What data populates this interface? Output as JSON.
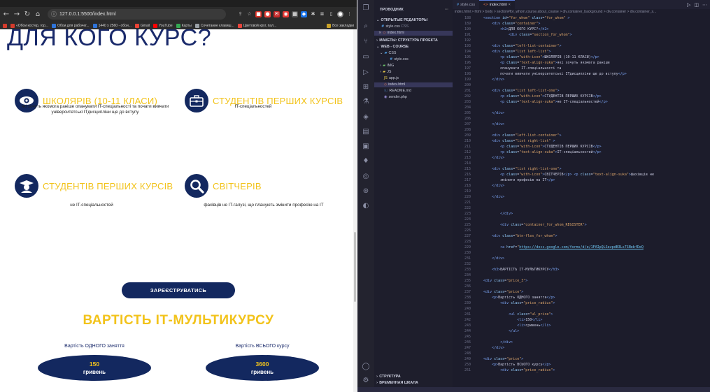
{
  "browser": {
    "url": "127.0.0.1:5500/index.html",
    "bookmarks": [
      {
        "label": "«Обои костер, гор...",
        "color": "#d33b2c"
      },
      {
        "label": "Обои для рабочег...",
        "color": "#2f74d9"
      },
      {
        "label": "1440 x 2560 - обои...",
        "color": "#2f74d9"
      },
      {
        "label": "Gmail",
        "color": "#ea4335"
      },
      {
        "label": "YouTube",
        "color": "#ff0000"
      },
      {
        "label": "Карты",
        "color": "#34a853"
      },
      {
        "label": "Сочетание клавиш...",
        "color": "#9aa0a6"
      },
      {
        "label": "Цветовой круг, пал...",
        "color": "#e8453c"
      }
    ],
    "all_bookmarks": "Все закладки"
  },
  "page": {
    "hero_title": "ДЛЯ КОГО КУРС?",
    "cards": [
      {
        "title": "ШКОЛЯРІВ (10-11 КЛАСИ)",
        "text": "які хочуть якомога раніше опанувати IT-спеціальності та почати вивчати університетські ІТдисципліни ще до вступу",
        "icon": "eye-icon"
      },
      {
        "title": "СТУДЕНТІВ ПЕРШИХ КУРСІВ",
        "text": "IT-спеціальностей",
        "icon": "briefcase-icon"
      },
      {
        "title": "СТУДЕНТІВ ПЕРШИХ КУРСІВ",
        "text": "не IT-спеціальностей",
        "icon": "graduate-icon"
      },
      {
        "title": "СВІТЧЕРІВ",
        "text": "фахівців не IT-галузі, що планують змінити професію на IT",
        "icon": "magnifier-icon"
      }
    ],
    "register_label": "ЗАРЕЄСТРУВАТИСЬ",
    "price_title": "ВАРТІСТЬ ІТ-МУЛЬТИКУРСУ",
    "prices": [
      {
        "label": "Вартість ОДНОГО заняття",
        "value": "150",
        "currency": "гривень"
      },
      {
        "label": "Вартість ВСЬОГО курсу",
        "value": "3600",
        "currency": "гривень"
      }
    ]
  },
  "vscode": {
    "explorer_title": "ПРОВОДНИК",
    "open_editors": "ОТКРЫТЫЕ РЕДАКТОРЫ",
    "open_files": [
      {
        "name": "style.css",
        "dir": "CSS"
      },
      {
        "name": "index.html",
        "dir": ""
      }
    ],
    "outline_title": "МАКЕТЫ: СТРУКТУРА ПРОЕКТА",
    "project": "WEB - COURSE",
    "tree": [
      "CSS",
      "style.css",
      "IMG",
      "JS",
      "app.js",
      "index.html",
      "README.md",
      "sender.php"
    ],
    "bottom_sections": [
      "СТРУКТУРА",
      "ВРЕМЕННАЯ ШКАЛА"
    ],
    "tabs": [
      {
        "label": "style.css",
        "icon": "#"
      },
      {
        "label": "index.html",
        "icon": "<>"
      }
    ],
    "breadcrumbs": "index.html > html > body > section#for_whom.course.about_course > div.container_background > div.container > div.container_s...",
    "code_lines": [
      {
        "n": "188",
        "html": "    <span class='t'>&lt;section</span> <span class='a'>id</span>=<span class='s'>\"for_whom\"</span> <span class='a'>class</span>=<span class='s'>\"for_whom\"</span> <span class='t'>&gt;</span>"
      },
      {
        "n": "189",
        "html": "        <span class='t'>&lt;div</span> <span class='a'>class</span>=<span class='s'>\"container\"</span><span class='t'>&gt;</span>"
      },
      {
        "n": "190",
        "html": "            <span class='t'>&lt;h2&gt;</span>ДЛЯ КОГО КУРС?<span class='t'>&lt;/h2&gt;</span>"
      },
      {
        "n": "191",
        "html": "                <span class='t'>&lt;div</span> <span class='a'>class</span>=<span class='s'>\"section_for_whom\"</span><span class='t'>&gt;</span>"
      },
      {
        "n": "192",
        "html": ""
      },
      {
        "n": "193",
        "html": "        <span class='t'>&lt;div</span> <span class='a'>class</span>=<span class='s'>\"left-list-container\"</span><span class='t'>&gt;</span>"
      },
      {
        "n": "194",
        "html": "        <span class='t'>&lt;div</span> <span class='a'>class</span>=<span class='s'>\"list left-list\"</span><span class='t'>&gt;</span>"
      },
      {
        "n": "195",
        "html": "            <span class='t'>&lt;p</span> <span class='a'>class</span>=<span class='s'>\"with-icon\"</span><span class='t'>&gt;</span>ШКОЛЯРІВ (10-11 КЛАСИ)<span class='t'>&lt;/p&gt;</span>"
      },
      {
        "n": "196",
        "html": "            <span class='t'>&lt;p</span> <span class='a'>class</span>=<span class='s'>\"text-align-suka\"</span><span class='t'>&gt;</span>які хочуть якомога раніше"
      },
      {
        "n": "197",
        "html": "            опанувати IT-спеціальності та"
      },
      {
        "n": "198",
        "html": "            почати вивчати університетські ІТдисципліни ще до вступу<span class='t'>&lt;/p&gt;</span>"
      },
      {
        "n": "199",
        "html": "        <span class='t'>&lt;/div&gt;</span>"
      },
      {
        "n": "200",
        "html": ""
      },
      {
        "n": "201",
        "html": "        <span class='t'>&lt;div</span> <span class='a'>class</span>=<span class='s'>\"list left-list-one\"</span><span class='t'>&gt;</span>"
      },
      {
        "n": "202",
        "html": "            <span class='t'>&lt;p</span> <span class='a'>class</span>=<span class='s'>\"with-icon\"</span><span class='t'>&gt;</span>СТУДЕНТІВ ПЕРШИХ КУРСІВ<span class='t'>&lt;/p&gt;</span>"
      },
      {
        "n": "203",
        "html": "            <span class='t'>&lt;p</span> <span class='a'>class</span>=<span class='s'>\"text-align-suka\"</span><span class='t'>&gt;</span>не IT-спеціальностей<span class='t'>&lt;/p&gt;</span>"
      },
      {
        "n": "204",
        "html": ""
      },
      {
        "n": "205",
        "html": "        <span class='t'>&lt;/div&gt;</span>"
      },
      {
        "n": "206",
        "html": ""
      },
      {
        "n": "207",
        "html": "        <span class='t'>&lt;/div&gt;</span>"
      },
      {
        "n": "208",
        "html": ""
      },
      {
        "n": "209",
        "html": "        <span class='t'>&lt;div</span> <span class='a'>class</span>=<span class='s'>\"left-list-container\"</span><span class='t'>&gt;</span>"
      },
      {
        "n": "210",
        "html": "        <span class='t'>&lt;div</span> <span class='a'>class</span>=<span class='s'>\"list right-list\"</span> <span class='t'>&gt;</span>"
      },
      {
        "n": "211",
        "html": "            <span class='t'>&lt;p</span> <span class='a'>class</span>=<span class='s'>\"with-icon\"</span><span class='t'>&gt;</span>СТУДЕНТІВ ПЕРШИХ КУРСІВ<span class='t'>&lt;/p&gt;</span>"
      },
      {
        "n": "212",
        "html": "            <span class='t'>&lt;p</span> <span class='a'>class</span>=<span class='s'>\"text-align-suka\"</span><span class='t'>&gt;</span>IT-спеціальностей<span class='t'>&lt;/p&gt;</span>"
      },
      {
        "n": "213",
        "html": "        <span class='t'>&lt;/div&gt;</span>"
      },
      {
        "n": "214",
        "html": ""
      },
      {
        "n": "215",
        "html": "        <span class='t'>&lt;div</span> <span class='a'>class</span>=<span class='s'>\"list right-list-one\"</span><span class='t'>&gt;</span>"
      },
      {
        "n": "216",
        "html": "            <span class='t'>&lt;p</span> <span class='a'>class</span>=<span class='s'>\"with-icon\"</span><span class='t'>&gt;</span>СВІТЧЕРІВ<span class='t'>&lt;/p&gt;</span> <span class='t'>&lt;p</span> <span class='a'>class</span>=<span class='s'>\"text-align-suka\"</span><span class='t'>&gt;</span>фахівців не"
      },
      {
        "n": "217",
        "html": "            змінити професію на IT<span class='t'>&lt;/p&gt;</span>"
      },
      {
        "n": "218",
        "html": "        <span class='t'>&lt;/div&gt;</span>"
      },
      {
        "n": "219",
        "html": ""
      },
      {
        "n": "220",
        "html": "        <span class='t'>&lt;/div&gt;</span>"
      },
      {
        "n": "221",
        "html": ""
      },
      {
        "n": "222",
        "html": ""
      },
      {
        "n": "223",
        "html": "            <span class='t'>&lt;/div&gt;</span>"
      },
      {
        "n": "224",
        "html": ""
      },
      {
        "n": "225",
        "html": "            <span class='t'>&lt;div</span> <span class='a'>class</span>=<span class='s'>\"container_for_whom_REGISTER\"</span><span class='t'>&gt;</span>"
      },
      {
        "n": "226",
        "html": ""
      },
      {
        "n": "227",
        "html": "        <span class='t'>&lt;div</span> <span class='a'>class</span>=<span class='s'>\"btn-flex_for_whom\"</span><span class='t'>&gt;</span>"
      },
      {
        "n": "228",
        "html": ""
      },
      {
        "n": "229",
        "html": "            <span class='t'>&lt;a</span> <span class='a'>href</span>=<span class='s'>\"</span><span class='u'>https://docs.google.com/forms/d/e/1FAIpQLSezpdB3Ls7SNebfDeQ</span>"
      },
      {
        "n": "230",
        "html": ""
      },
      {
        "n": "231",
        "html": "        <span class='t'>&lt;/div&gt;</span>"
      },
      {
        "n": "232",
        "html": ""
      },
      {
        "n": "233",
        "html": "        <span class='t'>&lt;h3&gt;</span>ВАРТІСТЬ ІТ-МУЛЬТИКУРСУ<span class='t'>&lt;/h3&gt;</span>"
      },
      {
        "n": "234",
        "html": ""
      },
      {
        "n": "235",
        "html": "    <span class='t'>&lt;div</span> <span class='a'>class</span>=<span class='s'>\"price_3\"</span><span class='t'>&gt;</span>"
      },
      {
        "n": "236",
        "html": ""
      },
      {
        "n": "237",
        "html": "    <span class='t'>&lt;div</span> <span class='a'>class</span>=<span class='s'>\"price\"</span><span class='t'>&gt;</span>"
      },
      {
        "n": "238",
        "html": "        <span class='t'>&lt;p&gt;</span>Вартість ОДНОГО заняття<span class='t'>&lt;/p&gt;</span>"
      },
      {
        "n": "239",
        "html": "            <span class='t'>&lt;div</span> <span class='a'>class</span>=<span class='s'>\"price_radius\"</span><span class='t'>&gt;</span>"
      },
      {
        "n": "240",
        "html": ""
      },
      {
        "n": "241",
        "html": "                <span class='t'>&lt;ul</span> <span class='a'>class</span>=<span class='s'>\"ul_price\"</span><span class='t'>&gt;</span>"
      },
      {
        "n": "242",
        "html": "                    <span class='t'>&lt;li&gt;</span>150<span class='t'>&lt;/li&gt;</span>"
      },
      {
        "n": "243",
        "html": "                    <span class='t'>&lt;li&gt;</span>гривень<span class='t'>&lt;/li&gt;</span>"
      },
      {
        "n": "244",
        "html": "                <span class='t'>&lt;/ul&gt;</span>"
      },
      {
        "n": "245",
        "html": ""
      },
      {
        "n": "246",
        "html": "            <span class='t'>&lt;/div&gt;</span>"
      },
      {
        "n": "247",
        "html": "        <span class='t'>&lt;/div&gt;</span>"
      },
      {
        "n": "248",
        "html": ""
      },
      {
        "n": "249",
        "html": "    <span class='t'>&lt;div</span> <span class='a'>class</span>=<span class='s'>\"price\"</span><span class='t'>&gt;</span>"
      },
      {
        "n": "250",
        "html": "        <span class='t'>&lt;p&gt;</span>Вартість ВСЬОГО курсу<span class='t'>&lt;/p&gt;</span>"
      },
      {
        "n": "251",
        "html": "            <span class='t'>&lt;div</span> <span class='a'>class</span>=<span class='s'>\"price_radius\"</span><span class='t'>&gt;</span>"
      }
    ]
  }
}
